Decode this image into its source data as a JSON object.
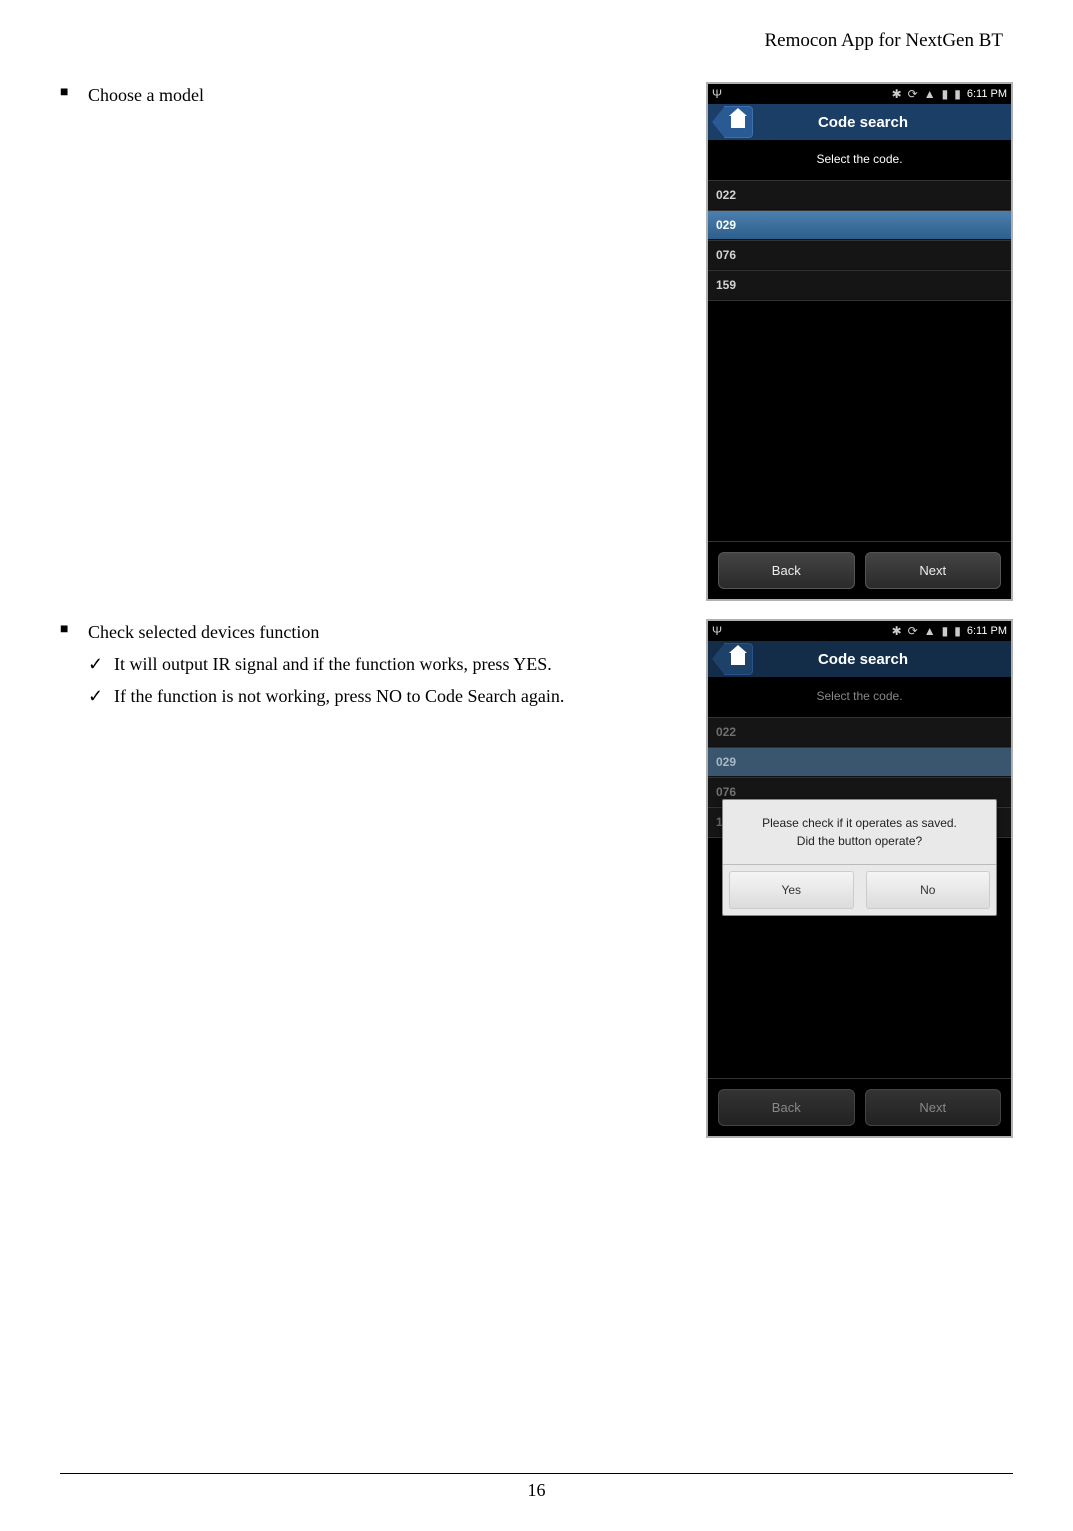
{
  "doc": {
    "header": "Remocon App for NextGen BT",
    "page_number": "16"
  },
  "section1": {
    "bullet": "Choose a model"
  },
  "section2": {
    "bullet": "Check selected devices function",
    "sub1": "It will output IR signal and if the function works, press YES.",
    "sub2": "If the function is not working, press NO to Code Search again."
  },
  "phone": {
    "time": "6:11 PM",
    "title": "Code search",
    "instruction": "Select the code.",
    "codes": [
      "022",
      "029",
      "076",
      "159"
    ],
    "selected_index": 1,
    "back_btn": "Back",
    "next_btn": "Next"
  },
  "dialog": {
    "line1": "Please check if it operates as saved.",
    "line2": "Did the button operate?",
    "yes": "Yes",
    "no": "No"
  }
}
